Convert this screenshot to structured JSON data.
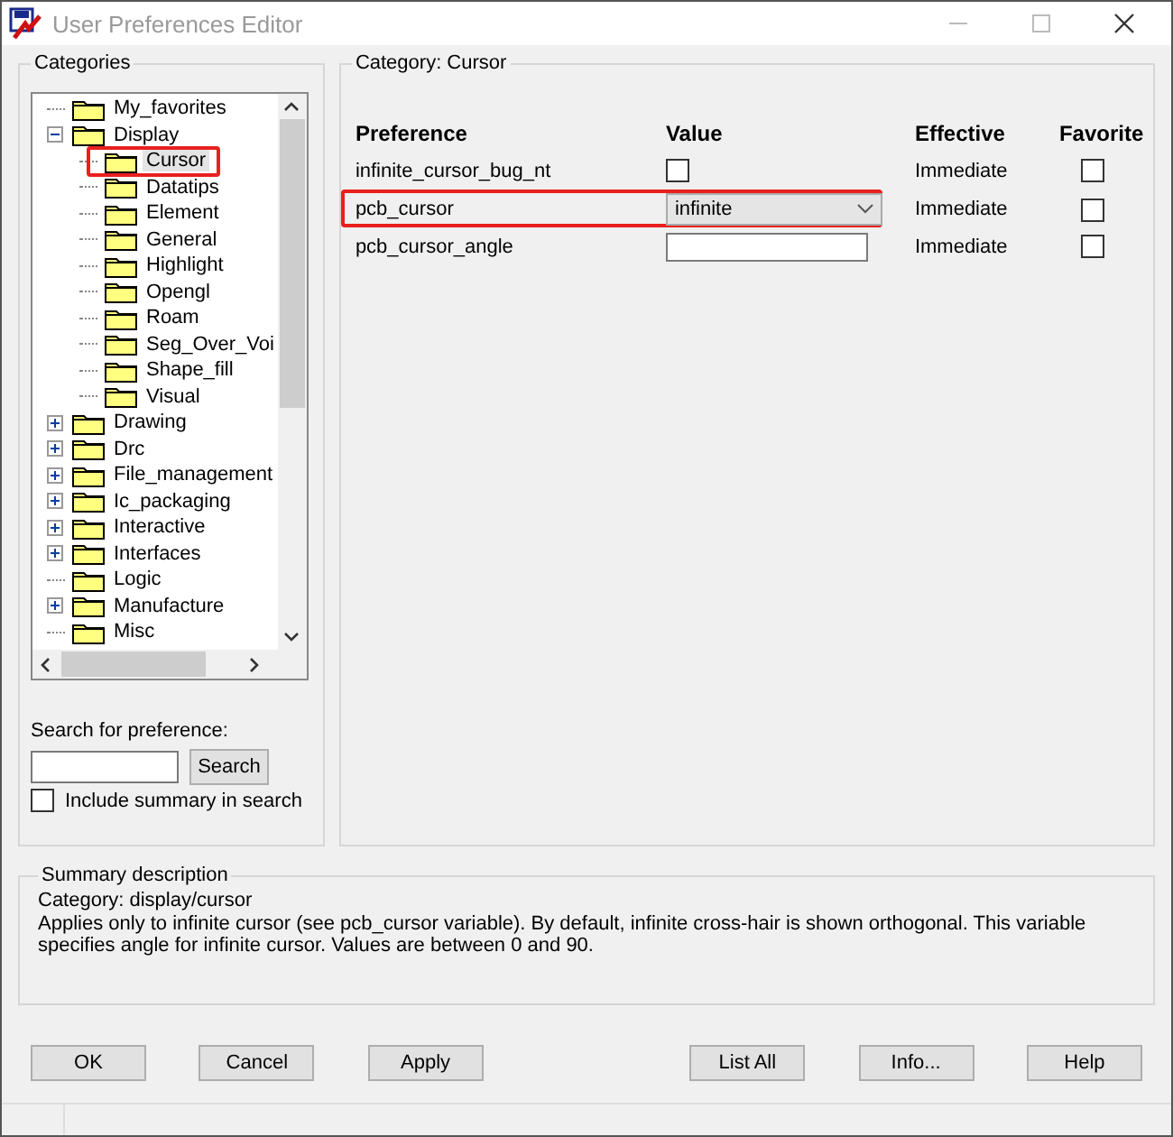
{
  "window": {
    "title": "User Preferences Editor"
  },
  "categories": {
    "title": "Categories",
    "tree": [
      {
        "label": "My_favorites",
        "selected": false
      },
      {
        "label": "Display",
        "expanded": true,
        "selected": false,
        "children": [
          {
            "label": "Cursor",
            "selected": true,
            "highlighted": true
          },
          {
            "label": "Datatips",
            "selected": false
          },
          {
            "label": "Element",
            "selected": false
          },
          {
            "label": "General",
            "selected": false
          },
          {
            "label": "Highlight",
            "selected": false
          },
          {
            "label": "Opengl",
            "selected": false
          },
          {
            "label": "Roam",
            "selected": false
          },
          {
            "label": "Seg_Over_Voi",
            "selected": false
          },
          {
            "label": "Shape_fill",
            "selected": false
          },
          {
            "label": "Visual",
            "selected": false
          }
        ]
      },
      {
        "label": "Drawing",
        "expanded": false,
        "selected": false
      },
      {
        "label": "Drc",
        "expanded": false,
        "selected": false
      },
      {
        "label": "File_management",
        "expanded": false,
        "selected": false
      },
      {
        "label": "Ic_packaging",
        "expanded": false,
        "selected": false
      },
      {
        "label": "Interactive",
        "expanded": false,
        "selected": false
      },
      {
        "label": "Interfaces",
        "expanded": false,
        "selected": false
      },
      {
        "label": "Logic",
        "selected": false
      },
      {
        "label": "Manufacture",
        "expanded": false,
        "selected": false
      },
      {
        "label": "Misc",
        "selected": false
      }
    ],
    "search_label": "Search for preference:",
    "search_button": "Search",
    "include_summary": {
      "label": "Include summary in search",
      "checked": false
    }
  },
  "preferences": {
    "title": "Category:  Cursor",
    "columns": [
      "Preference",
      "Value",
      "Effective",
      "Favorite"
    ],
    "rows": [
      {
        "name": "infinite_cursor_bug_nt",
        "kind": "checkbox",
        "checked": false,
        "effective": "Immediate",
        "favorite": false,
        "highlighted": false
      },
      {
        "name": "pcb_cursor",
        "kind": "dropdown",
        "value": "infinite",
        "effective": "Immediate",
        "favorite": false,
        "highlighted": true
      },
      {
        "name": "pcb_cursor_angle",
        "kind": "text",
        "effective": "Immediate",
        "favorite": false,
        "highlighted": false
      }
    ]
  },
  "summary": {
    "title": "Summary description",
    "lines": [
      "Category: display/cursor",
      "Applies only to infinite cursor (see pcb_cursor variable). By default, infinite cross-hair is shown orthogonal. This variable specifies angle for infinite cursor. Values are between 0  and 90."
    ]
  },
  "buttons": [
    "OK",
    "Cancel",
    "Apply",
    "List All",
    "Info...",
    "Help"
  ]
}
